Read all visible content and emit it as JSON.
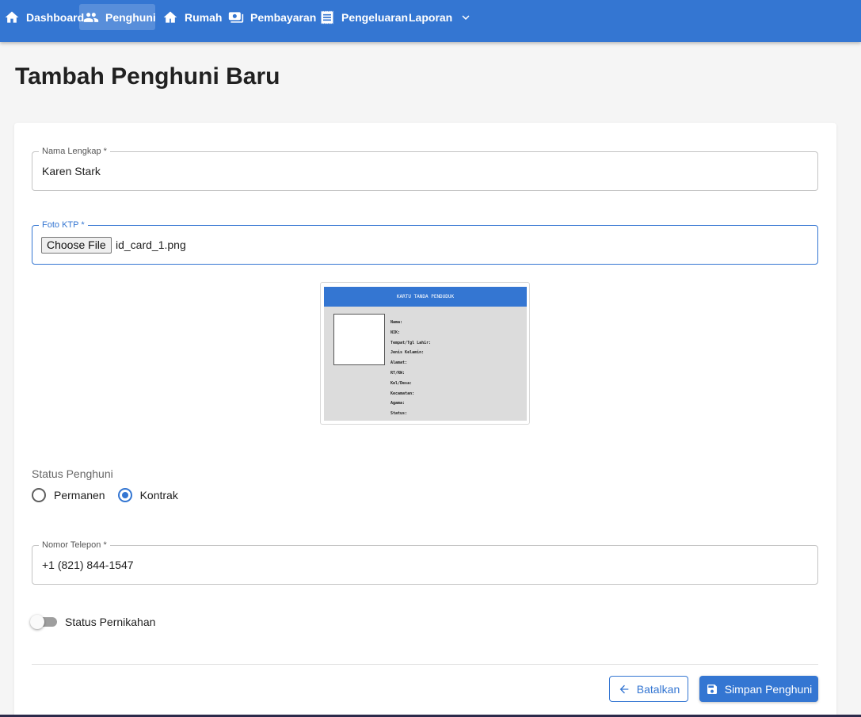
{
  "nav": {
    "items": [
      {
        "label": "Dashboard",
        "icon": "home-icon"
      },
      {
        "label": "Penghuni",
        "icon": "people-icon",
        "active": true
      },
      {
        "label": "Rumah",
        "icon": "house-icon"
      },
      {
        "label": "Pembayaran",
        "icon": "payment-icon"
      },
      {
        "label": "Pengeluaran",
        "icon": "receipt-icon"
      },
      {
        "label": "Laporan",
        "icon": "chevron-down-icon"
      }
    ]
  },
  "page": {
    "title": "Tambah Penghuni Baru"
  },
  "form": {
    "name": {
      "label": "Nama Lengkap *",
      "value": "Karen Stark"
    },
    "ktp": {
      "label": "Foto KTP  *",
      "button_label": "Choose File",
      "file_name": "id_card_1.png"
    },
    "ktp_preview": {
      "header": "KARTU TANDA PENDUDUK",
      "fields": [
        "Nama:",
        "NIK:",
        "Tempat/Tgl Lahir:",
        "Jenis Kelamin:",
        "Alamat:",
        "RT/RW:",
        "Kel/Desa:",
        "Kecamatan:",
        "Agama:",
        "Status:"
      ]
    },
    "status": {
      "label": "Status Penghuni",
      "options": [
        {
          "label": "Permanen",
          "checked": false
        },
        {
          "label": "Kontrak",
          "checked": true
        }
      ]
    },
    "phone": {
      "label": "Nomor Telepon *",
      "value": "+1 (821) 844-1547"
    },
    "marriage": {
      "label": "Status Pernikahan",
      "on": false
    },
    "actions": {
      "cancel_label": "Batalkan",
      "save_label": "Simpan Penghuni"
    }
  },
  "colors": {
    "primary": "#3476d2"
  }
}
